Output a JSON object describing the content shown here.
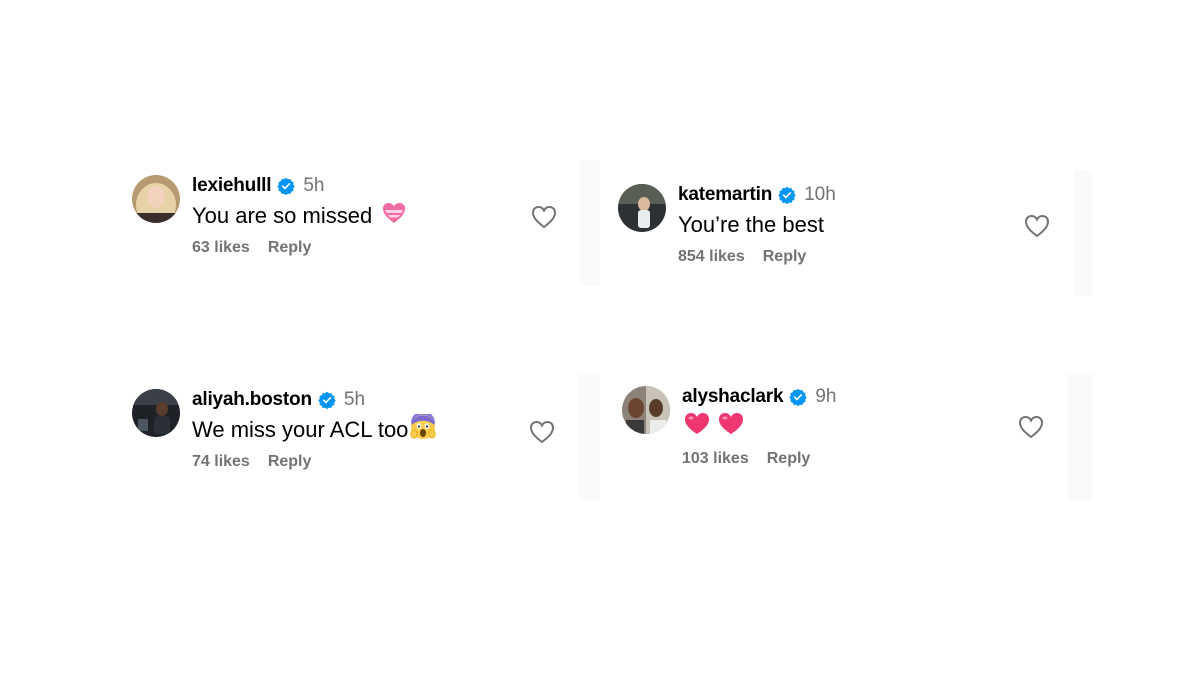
{
  "comments": [
    {
      "username": "lexiehulll",
      "time": "5h",
      "text": "You are so missed",
      "emoji": "pink-heart-emoji",
      "likes": "63 likes",
      "reply": "Reply"
    },
    {
      "username": "katemartin",
      "time": "10h",
      "text": "You’re the best",
      "emoji": "",
      "likes": "854 likes",
      "reply": "Reply"
    },
    {
      "username": "aliyah.boston",
      "time": "5h",
      "text": "We miss your ACL too",
      "emoji": "screaming-face-emoji",
      "likes": "74 likes",
      "reply": "Reply"
    },
    {
      "username": "alyshaclark",
      "time": "9h",
      "text": "",
      "emoji": "two-red-hearts-emoji",
      "likes": "103 likes",
      "reply": "Reply"
    }
  ],
  "colors": {
    "verified": "#0095f6",
    "secondary_text": "#737373",
    "heart_outline": "#737373",
    "panel_bg": "#fafafa"
  }
}
